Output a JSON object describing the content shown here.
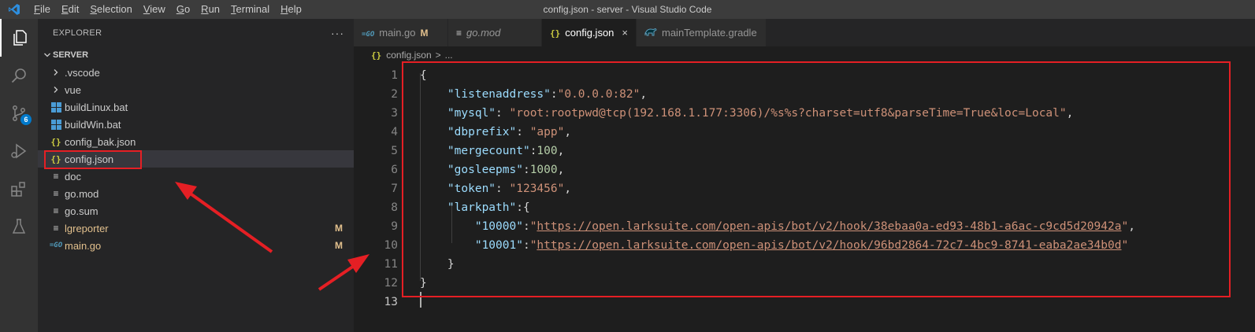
{
  "window": {
    "title": "config.json - server - Visual Studio Code",
    "menu": [
      {
        "u": "F",
        "rest": "ile"
      },
      {
        "u": "E",
        "rest": "dit"
      },
      {
        "u": "S",
        "rest": "election"
      },
      {
        "u": "V",
        "rest": "iew"
      },
      {
        "u": "G",
        "rest": "o"
      },
      {
        "u": "R",
        "rest": "un"
      },
      {
        "u": "T",
        "rest": "erminal"
      },
      {
        "u": "H",
        "rest": "elp"
      }
    ]
  },
  "activity": {
    "scm_badge": "6",
    "icons": [
      "explorer-icon",
      "search-icon",
      "source-control-icon",
      "run-debug-icon",
      "extensions-icon",
      "testing-icon"
    ]
  },
  "sidebar": {
    "title": "EXPLORER",
    "more": "···",
    "section": "SERVER",
    "items": [
      {
        "label": ".vscode",
        "icon": "chevron-right-icon",
        "git": ""
      },
      {
        "label": "vue",
        "icon": "chevron-right-icon",
        "git": ""
      },
      {
        "label": "buildLinux.bat",
        "icon": "windows-batch-icon",
        "git": ""
      },
      {
        "label": "buildWin.bat",
        "icon": "windows-batch-icon",
        "git": ""
      },
      {
        "label": "config_bak.json",
        "icon": "json-icon",
        "git": ""
      },
      {
        "label": "config.json",
        "icon": "json-icon",
        "git": ""
      },
      {
        "label": "doc",
        "icon": "file-lines-icon",
        "git": ""
      },
      {
        "label": "go.mod",
        "icon": "file-lines-icon",
        "git": ""
      },
      {
        "label": "go.sum",
        "icon": "file-lines-icon",
        "git": ""
      },
      {
        "label": "lgreporter",
        "icon": "file-lines-icon",
        "git": "M"
      },
      {
        "label": "main.go",
        "icon": "go-icon",
        "git": "M"
      }
    ]
  },
  "tabs": [
    {
      "label": "main.go",
      "icon": "go-icon",
      "modified": "M"
    },
    {
      "label": "go.mod",
      "icon": "file-lines-icon",
      "modified": ""
    },
    {
      "label": "config.json",
      "icon": "json-icon",
      "modified": "",
      "close": "×"
    },
    {
      "label": "mainTemplate.gradle",
      "icon": "gradle-icon",
      "modified": ""
    }
  ],
  "breadcrumb": {
    "file": "config.json",
    "sep": ">",
    "rest": "..."
  },
  "editor": {
    "line_numbers": [
      "1",
      "2",
      "3",
      "4",
      "5",
      "6",
      "7",
      "8",
      "9",
      "10",
      "11",
      "12",
      "13"
    ],
    "lines": [
      [
        {
          "t": "p",
          "v": "{"
        }
      ],
      [
        {
          "t": "p",
          "v": "    "
        },
        {
          "t": "k",
          "v": "\"listenaddress\""
        },
        {
          "t": "p",
          "v": ":"
        },
        {
          "t": "s",
          "v": "\"0.0.0.0:82\""
        },
        {
          "t": "p",
          "v": ","
        }
      ],
      [
        {
          "t": "p",
          "v": "    "
        },
        {
          "t": "k",
          "v": "\"mysql\""
        },
        {
          "t": "p",
          "v": ": "
        },
        {
          "t": "s",
          "v": "\"root:rootpwd@tcp(192.168.1.177:3306)/%s%s?charset=utf8&parseTime=True&loc=Local\""
        },
        {
          "t": "p",
          "v": ","
        }
      ],
      [
        {
          "t": "p",
          "v": "    "
        },
        {
          "t": "k",
          "v": "\"dbprefix\""
        },
        {
          "t": "p",
          "v": ": "
        },
        {
          "t": "s",
          "v": "\"app\""
        },
        {
          "t": "p",
          "v": ","
        }
      ],
      [
        {
          "t": "p",
          "v": "    "
        },
        {
          "t": "k",
          "v": "\"mergecount\""
        },
        {
          "t": "p",
          "v": ":"
        },
        {
          "t": "n",
          "v": "100"
        },
        {
          "t": "p",
          "v": ","
        }
      ],
      [
        {
          "t": "p",
          "v": "    "
        },
        {
          "t": "k",
          "v": "\"gosleepms\""
        },
        {
          "t": "p",
          "v": ":"
        },
        {
          "t": "n",
          "v": "1000"
        },
        {
          "t": "p",
          "v": ","
        }
      ],
      [
        {
          "t": "p",
          "v": "    "
        },
        {
          "t": "k",
          "v": "\"token\""
        },
        {
          "t": "p",
          "v": ": "
        },
        {
          "t": "s",
          "v": "\"123456\""
        },
        {
          "t": "p",
          "v": ","
        }
      ],
      [
        {
          "t": "p",
          "v": "    "
        },
        {
          "t": "k",
          "v": "\"larkpath\""
        },
        {
          "t": "p",
          "v": ":{"
        }
      ],
      [
        {
          "t": "p",
          "v": "        "
        },
        {
          "t": "k",
          "v": "\"10000\""
        },
        {
          "t": "p",
          "v": ":"
        },
        {
          "t": "s",
          "v": "\""
        },
        {
          "t": "u",
          "v": "https://open.larksuite.com/open-apis/bot/v2/hook/38ebaa0a-ed93-48b1-a6ac-c9cd5d20942a"
        },
        {
          "t": "s",
          "v": "\""
        },
        {
          "t": "p",
          "v": ","
        }
      ],
      [
        {
          "t": "p",
          "v": "        "
        },
        {
          "t": "k",
          "v": "\"10001\""
        },
        {
          "t": "p",
          "v": ":"
        },
        {
          "t": "s",
          "v": "\""
        },
        {
          "t": "u",
          "v": "https://open.larksuite.com/open-apis/bot/v2/hook/96bd2864-72c7-4bc9-8741-eaba2ae34b0d"
        },
        {
          "t": "s",
          "v": "\""
        }
      ],
      [
        {
          "t": "p",
          "v": "    }"
        }
      ],
      [
        {
          "t": "p",
          "v": "}"
        }
      ],
      []
    ]
  },
  "colors": {
    "annotation": "#e51f24",
    "accent": "#007acc",
    "modified": "#e2c08d"
  }
}
